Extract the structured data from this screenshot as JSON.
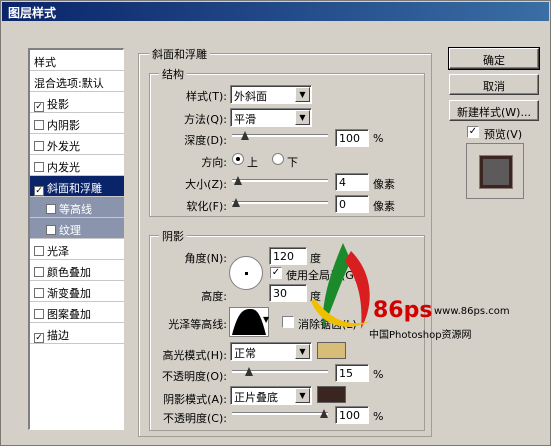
{
  "window": {
    "title": "图层样式"
  },
  "sidebar": {
    "header": "样式",
    "blend_default": "混合选项:默认",
    "items": [
      {
        "label": "投影",
        "checked": true
      },
      {
        "label": "内阴影",
        "checked": false
      },
      {
        "label": "外发光",
        "checked": false
      },
      {
        "label": "内发光",
        "checked": false
      },
      {
        "label": "斜面和浮雕",
        "checked": true,
        "selected": true
      },
      {
        "label": "等高线",
        "checked": false,
        "sub": true
      },
      {
        "label": "纹理",
        "checked": false,
        "sub": true
      },
      {
        "label": "光泽",
        "checked": false
      },
      {
        "label": "颜色叠加",
        "checked": false
      },
      {
        "label": "渐变叠加",
        "checked": false
      },
      {
        "label": "图案叠加",
        "checked": false
      },
      {
        "label": "描边",
        "checked": true
      }
    ]
  },
  "bevel": {
    "group_title": "斜面和浮雕",
    "structure": {
      "title": "结构",
      "style_label": "样式(T):",
      "style_value": "外斜面",
      "technique_label": "方法(Q):",
      "technique_value": "平滑",
      "depth_label": "深度(D):",
      "depth_value": "100",
      "depth_unit": "%",
      "depth_fraction": 0.1,
      "direction_label": "方向:",
      "direction_up": "上",
      "direction_down": "下",
      "size_label": "大小(Z):",
      "size_value": "4",
      "size_unit": "像素",
      "size_fraction": 0.02,
      "soften_label": "软化(F):",
      "soften_value": "0",
      "soften_unit": "像素",
      "soften_fraction": 0.0
    },
    "shading": {
      "title": "阴影",
      "angle_label": "角度(N):",
      "angle_value": "120",
      "angle_unit": "度",
      "global_light_label": "使用全局光(G)",
      "global_light_checked": true,
      "altitude_label": "高度:",
      "altitude_value": "30",
      "altitude_unit": "度",
      "gloss_label": "光泽等高线:",
      "antialias_label": "消除锯齿(L)",
      "antialias_checked": false,
      "highlight_mode_label": "高光模式(H):",
      "highlight_mode_value": "正常",
      "highlight_color": "#d8bd78",
      "highlight_opacity_label": "不透明度(O):",
      "highlight_opacity_value": "15",
      "highlight_opacity_unit": "%",
      "highlight_opacity_fraction": 0.15,
      "shadow_mode_label": "阴影模式(A):",
      "shadow_mode_value": "正片叠底",
      "shadow_color": "#3b2520",
      "shadow_opacity_label": "不透明度(C):",
      "shadow_opacity_value": "100",
      "shadow_opacity_unit": "%",
      "shadow_opacity_fraction": 1.0
    }
  },
  "buttons": {
    "ok": "确定",
    "cancel": "取消",
    "new_style": "新建样式(W)...",
    "preview_label": "预览(V)",
    "preview_checked": true
  },
  "watermark": {
    "brand": "86ps",
    "url": "www.86ps.com",
    "cn": "中国Photoshop资源网"
  }
}
